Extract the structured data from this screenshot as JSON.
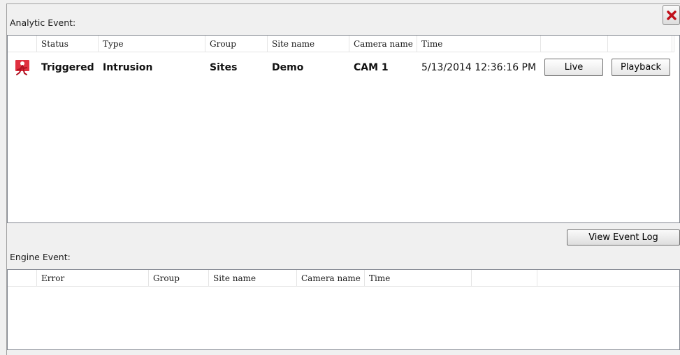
{
  "analytic_section": {
    "label": "Analytic Event:",
    "columns": [
      "",
      "Status",
      "Type",
      "Group",
      "Site name",
      "Camera name",
      "Time",
      "",
      ""
    ],
    "rows": [
      {
        "icon": "intrusion-alarm-icon",
        "status": "Triggered",
        "type": "Intrusion",
        "group": "Sites",
        "site_name": "Demo",
        "camera_name": "CAM  1",
        "time": "5/13/2014 12:36:16 PM",
        "live_label": "Live",
        "playback_label": "Playback"
      }
    ]
  },
  "view_event_log_label": "View Event Log",
  "engine_section": {
    "label": "Engine Event:",
    "columns": [
      "",
      "Error",
      "Group",
      "Site name",
      "Camera name",
      "Time",
      "",
      ""
    ]
  },
  "colors": {
    "close_x": "#c0101a",
    "icon_red": "#e03040"
  }
}
